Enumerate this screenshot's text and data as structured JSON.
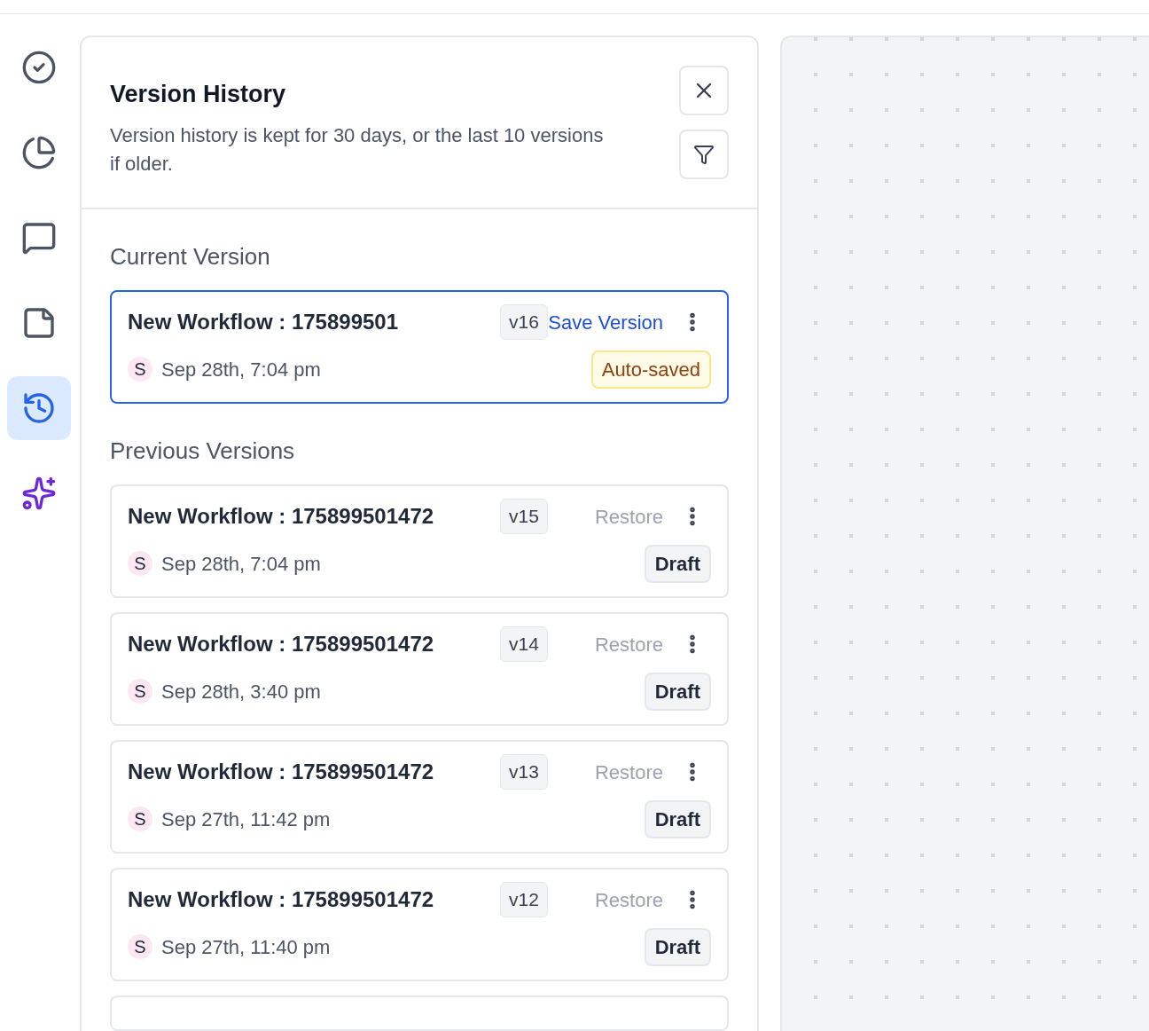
{
  "sidebar": {
    "items": [
      {
        "kind": "check",
        "selected": false
      },
      {
        "kind": "chart",
        "selected": false
      },
      {
        "kind": "comment",
        "selected": false
      },
      {
        "kind": "note",
        "selected": false
      },
      {
        "kind": "history",
        "selected": true
      },
      {
        "kind": "ai",
        "selected": false
      }
    ]
  },
  "panel": {
    "title": "Version History",
    "description": "Version history is kept for 30 days, or the last 10 versions if older.",
    "current": {
      "heading": "Current Version",
      "version": {
        "name": "New Workflow : 175899501",
        "tag": "v16",
        "action": "Save Version",
        "avatar": "S",
        "date": "Sep 28th, 7:04 pm",
        "status": "Auto-saved",
        "kind": "autosaved"
      }
    },
    "previous": {
      "heading": "Previous Versions",
      "versions": [
        {
          "name": "New Workflow : 175899501472",
          "tag": "v15",
          "action": "Restore",
          "avatar": "S",
          "date": "Sep 28th, 7:04 pm",
          "status": "Draft",
          "kind": "draft"
        },
        {
          "name": "New Workflow : 175899501472",
          "tag": "v14",
          "action": "Restore",
          "avatar": "S",
          "date": "Sep 28th, 3:40 pm",
          "status": "Draft",
          "kind": "draft"
        },
        {
          "name": "New Workflow : 175899501472",
          "tag": "v13",
          "action": "Restore",
          "avatar": "S",
          "date": "Sep 27th, 11:42 pm",
          "status": "Draft",
          "kind": "draft"
        },
        {
          "name": "New Workflow : 175899501472",
          "tag": "v12",
          "action": "Restore",
          "avatar": "S",
          "date": "Sep 27th, 11:40 pm",
          "status": "Draft",
          "kind": "draft"
        }
      ]
    }
  }
}
